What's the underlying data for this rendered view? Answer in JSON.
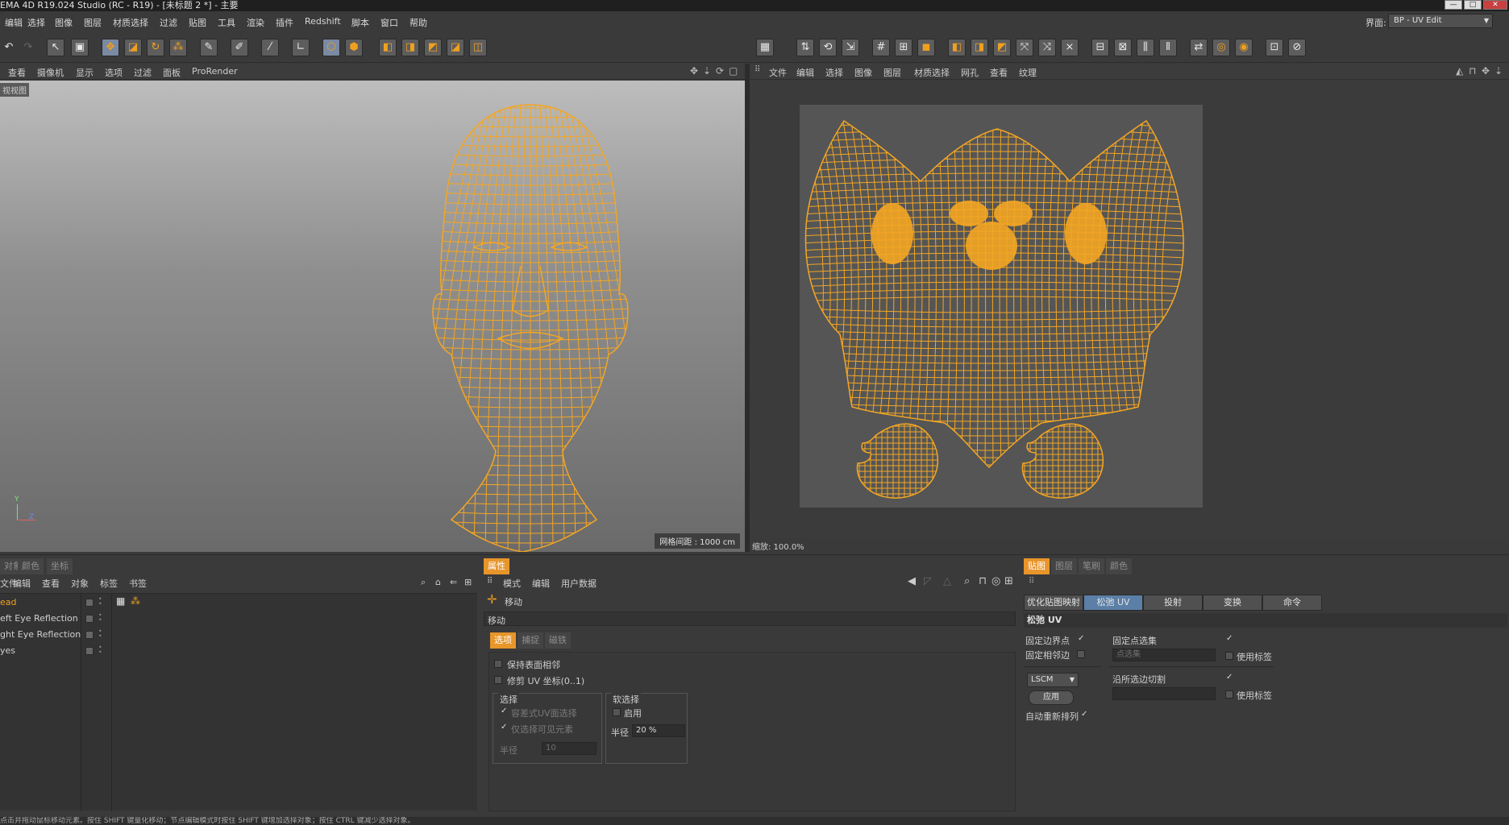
{
  "window": {
    "title": "EMA 4D R19.024 Studio (RC - R19) - [未标题 2 *] - 主要",
    "controls": [
      "—",
      "□",
      "✕"
    ]
  },
  "menubar": {
    "items": [
      "编辑",
      "选择",
      "图像",
      "图层",
      "材质选择",
      "过滤",
      "贴图",
      "工具",
      "渲染",
      "插件",
      "Redshift",
      "脚本",
      "窗口",
      "帮助"
    ],
    "layout_label": "界面:",
    "layout_value": "BP - UV Edit"
  },
  "viewport": {
    "menu": [
      "查看",
      "摄像机",
      "显示",
      "选项",
      "过滤",
      "面板",
      "ProRender"
    ],
    "name_tag": "视视图",
    "grid_spacing": "网格间距 : 1000 cm",
    "axis_y": "Y",
    "axis_z": "Z",
    "wire_color": "#f4a623"
  },
  "uv_editor": {
    "menu": [
      "文件",
      "编辑",
      "选择",
      "图像",
      "图层",
      "材质选择",
      "网孔",
      "查看",
      "纹理"
    ],
    "zoom": "缩放: 100.0%"
  },
  "object_manager": {
    "tabs": [
      "对象",
      "颜色",
      "坐标"
    ],
    "menu": [
      "文件",
      "编辑",
      "查看",
      "对象",
      "标签",
      "书签"
    ],
    "objects": [
      {
        "name": "ead",
        "selected": true
      },
      {
        "name": "eft Eye Reflection",
        "selected": false
      },
      {
        "name": "ght Eye Reflection",
        "selected": false
      },
      {
        "name": "yes",
        "selected": false
      }
    ]
  },
  "attribute_manager": {
    "tab": "属性",
    "menu": [
      "模式",
      "编辑",
      "用户数据"
    ],
    "tool_name": "移动",
    "section": "移动",
    "subtabs": [
      "选项",
      "捕捉",
      "磁铁"
    ],
    "keep_surface_neighbors": "保持表面相邻",
    "fix_uv": "修剪 UV 坐标(0..1)",
    "select_group": "选择",
    "tolerant_select": "容差式UV面选择",
    "visible_only": "仅选择可见元素",
    "radius_label": "半径",
    "radius_value": "10",
    "soft_group": "软选择",
    "soft_enable": "启用",
    "soft_radius_label": "半径",
    "soft_radius_value": "20 %"
  },
  "texture_manager": {
    "tabs": [
      "贴图",
      "图层",
      "笔刷",
      "颜色"
    ],
    "buttons": [
      "优化贴图映射",
      "松弛 UV",
      "投射",
      "变换",
      "命令"
    ],
    "section_title": "松弛 UV",
    "pin_border": "固定边界点",
    "pin_neighbor": "固定相邻边",
    "pin_point_sel": "固定点选集",
    "point_sel_placeholder": "点选集",
    "use_tag_1": "使用标签",
    "method": "LSCM",
    "apply": "应用",
    "cut_selected_edges": "沿所选边切割",
    "use_tag_2": "使用标签",
    "auto_realign": "自动重新排列"
  },
  "status": "点击并拖动鼠标移动元素。按住 SHIFT 键量化移动；节点编辑模式时按住 SHIFT 键增加选择对象；按住 CTRL 键减少选择对象。"
}
